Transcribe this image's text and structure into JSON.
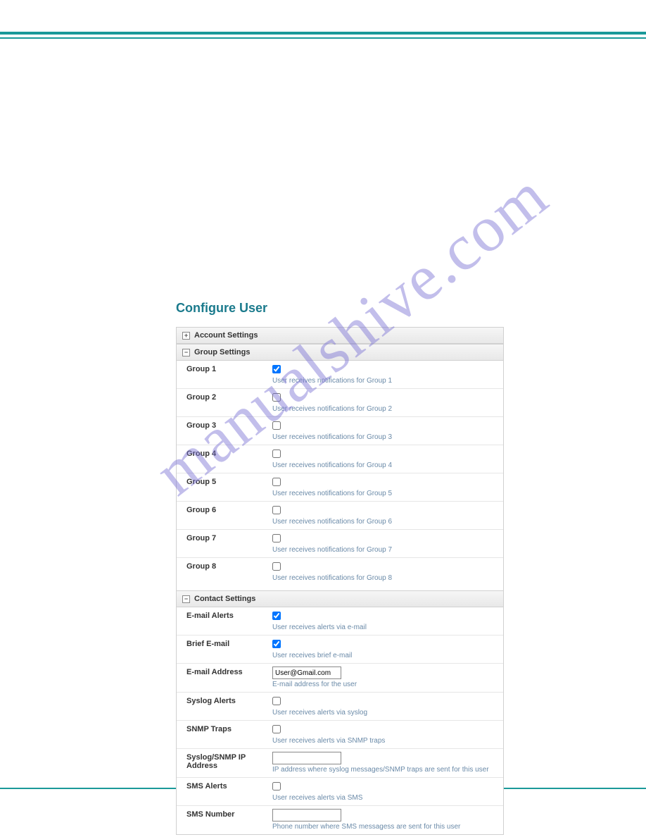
{
  "page_title": "Configure User",
  "watermark_text": "manualshive.com",
  "sections": {
    "account": {
      "title": "Account Settings",
      "expanded": false
    },
    "group": {
      "title": "Group Settings",
      "expanded": true,
      "rows": [
        {
          "label": "Group 1",
          "checked": true,
          "desc": "User receives notifications for Group 1"
        },
        {
          "label": "Group 2",
          "checked": false,
          "desc": "User receives notifications for Group 2"
        },
        {
          "label": "Group 3",
          "checked": false,
          "desc": "User receives notifications for Group 3"
        },
        {
          "label": "Group 4",
          "checked": false,
          "desc": "User receives notifications for Group 4"
        },
        {
          "label": "Group 5",
          "checked": false,
          "desc": "User receives notifications for Group 5"
        },
        {
          "label": "Group 6",
          "checked": false,
          "desc": "User receives notifications for Group 6"
        },
        {
          "label": "Group 7",
          "checked": false,
          "desc": "User receives notifications for Group 7"
        },
        {
          "label": "Group 8",
          "checked": false,
          "desc": "User receives notifications for Group 8"
        }
      ]
    },
    "contact": {
      "title": "Contact Settings",
      "expanded": true,
      "rows": [
        {
          "kind": "check",
          "label": "E-mail Alerts",
          "checked": true,
          "desc": "User receives alerts via e-mail"
        },
        {
          "kind": "check",
          "label": "Brief E-mail",
          "checked": true,
          "desc": "User receives brief e-mail"
        },
        {
          "kind": "text",
          "label": "E-mail Address",
          "value": "User@Gmail.com",
          "desc": "E-mail address for the user"
        },
        {
          "kind": "check",
          "label": "Syslog Alerts",
          "checked": false,
          "desc": "User receives alerts via syslog"
        },
        {
          "kind": "check",
          "label": "SNMP Traps",
          "checked": false,
          "desc": "User receives alerts via SNMP traps"
        },
        {
          "kind": "text",
          "label": "Syslog/SNMP IP Address",
          "value": "",
          "desc": "IP address where syslog messages/SNMP traps are sent for this user"
        },
        {
          "kind": "check",
          "label": "SMS Alerts",
          "checked": false,
          "desc": "User receives alerts via SMS"
        },
        {
          "kind": "text",
          "label": "SMS Number",
          "value": "",
          "desc": "Phone number where SMS messagess are sent for this user"
        }
      ]
    }
  }
}
